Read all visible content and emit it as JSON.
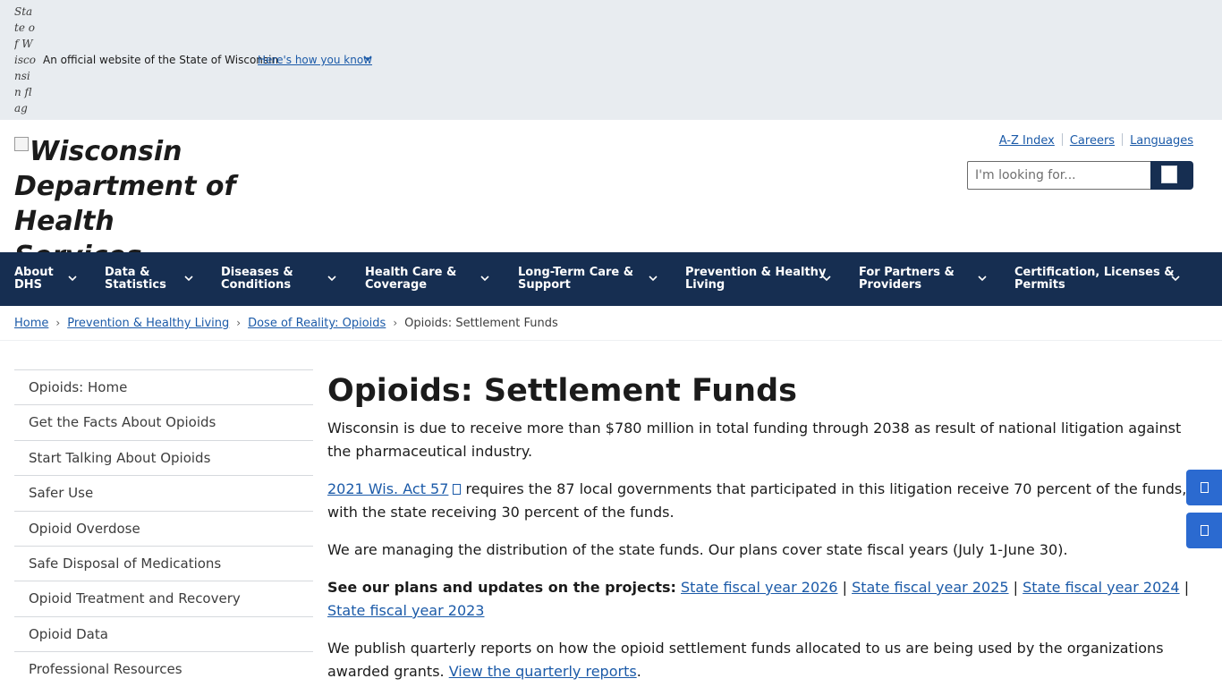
{
  "gov_banner": {
    "flag_alt": "State of Wisconsin flag",
    "text": "An official website of the State of Wisconsin",
    "link": "Here's how you know",
    "chevron_icon": "chevron-down-icon"
  },
  "header": {
    "logo_alt": "Wisconsin Department of Health Services",
    "utility_links": [
      "A-Z Index",
      "Careers",
      "Languages"
    ],
    "search": {
      "placeholder": "I'm looking for...",
      "button_icon": "search-icon"
    }
  },
  "nav": {
    "items": [
      "About\nDHS",
      "Data &\nStatistics",
      "Diseases &\nConditions",
      "Health Care &\nCoverage",
      "Long-Term Care &\nSupport",
      "Prevention & Healthy\nLiving",
      "For Partners &\nProviders",
      "Certification, Licenses &\nPermits"
    ]
  },
  "breadcrumb": {
    "items": [
      "Home",
      "Prevention & Healthy Living",
      "Dose of Reality: Opioids"
    ],
    "separator": "›",
    "current": "Opioids: Settlement Funds"
  },
  "sidebar": {
    "items": [
      "Opioids: Home",
      "Get the Facts About Opioids",
      "Start Talking About Opioids",
      "Safer Use",
      "Opioid Overdose",
      "Safe Disposal of Medications",
      "Opioid Treatment and Recovery",
      "Opioid Data",
      "Professional Resources"
    ]
  },
  "content": {
    "title": "Opioids: Settlement Funds",
    "p1": "Wisconsin is due to receive more than $780 million in total funding through 2038 as result of national litigation against the pharmaceutical industry.",
    "p2_link": "2021 Wis. Act 57",
    "p2_text": " requires the 87 local governments that participated in this litigation receive 70 percent of the funds, with the state receiving 30 percent of the funds.",
    "p3": "We are managing the distribution of the state funds. Our plans cover state fiscal years (July 1-June 30).",
    "p4_bold": "See our plans and updates on the projects:",
    "p4_links": [
      "State fiscal year 2026",
      "State fiscal year 2025",
      "State fiscal year 2024",
      "State fiscal year 2023"
    ],
    "pipe": "|",
    "p5_text": "We publish quarterly reports on how the opioid settlement funds allocated to us are being used by the organizations awarded grants. ",
    "p5_link": "View the quarterly reports",
    "p5_end": "."
  },
  "float_buttons": [
    "feedback-icon",
    "share-icon"
  ],
  "colors": {
    "nav_bg": "#162e51",
    "link": "#1b5aa8",
    "banner_bg": "#e8ecf0",
    "float_btn": "#2b6ad0"
  }
}
